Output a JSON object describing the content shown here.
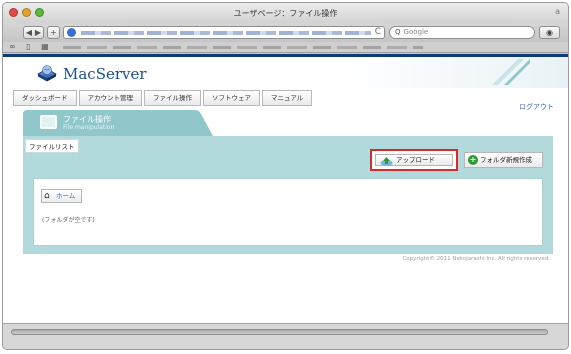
{
  "window": {
    "title": "ユーザページ：ファイル操作",
    "title_right_glyph": "a",
    "url_icon": "globe-icon",
    "reload_glyph": "C",
    "search_placeholder": "Google",
    "search_glyph": "Q"
  },
  "header": {
    "logo_text": "MacServer",
    "logout": "ログアウト"
  },
  "nav": {
    "items": [
      "ダッシュボード",
      "アカウント管理",
      "ファイル操作",
      "ソフトウェア",
      "マニュアル"
    ]
  },
  "panel": {
    "title": "ファイル操作",
    "subtitle": "File manipulation",
    "filelist_label": "ファイルリスト",
    "upload_button": "アップロード",
    "new_folder_button": "フォルダ新規作成",
    "home_button": "ホーム",
    "empty_message": "(フォルダが空です)"
  },
  "footer": {
    "copyright": "Copyright© 2011 Nekojarashi Inc. All rights reserved."
  },
  "colors": {
    "brand_blue": "#0d3a78",
    "panel_teal": "#b2dadc",
    "tab_teal": "#8fc7cb",
    "highlight_red": "#d52b2b",
    "link_blue": "#3a6db5"
  }
}
